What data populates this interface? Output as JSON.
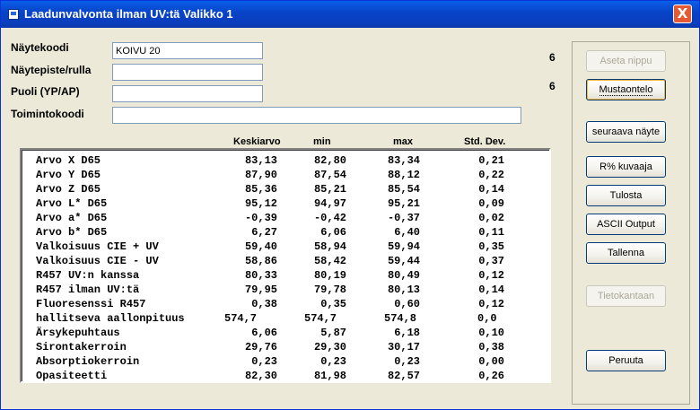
{
  "window": {
    "title": "Laadunvalvonta ilman UV:tä  Valikko 1",
    "close_label": "X"
  },
  "form": {
    "sample_code": {
      "label": "Näytekoodi",
      "value": "KOIVU 20"
    },
    "sample_point": {
      "label": "Näytepiste/rulla",
      "value": ""
    },
    "side": {
      "label": "Puoli (YP/AP)",
      "value": ""
    },
    "action_code": {
      "label": "Toimintokoodi",
      "value": ""
    }
  },
  "counts": {
    "bundle": "6",
    "black_cavity": "6"
  },
  "buttons": {
    "set_bundle": "Aseta nippu",
    "black_cavity": "Mustaontelo",
    "next_sample": "seuraava näyte",
    "r_percent_graph": "R% kuvaaja",
    "print": "Tulosta",
    "ascii_output": "ASCII Output",
    "save": "Tallenna",
    "database": "Tietokantaan",
    "cancel": "Peruuta"
  },
  "table": {
    "headers": {
      "avg": "Keskiarvo",
      "min": "min",
      "max": "max",
      "std": "Std. Dev."
    },
    "rows": [
      {
        "name": "Arvo X D65",
        "avg": "83,13",
        "min": "82,80",
        "max": "83,34",
        "std": "0,21"
      },
      {
        "name": "Arvo Y D65",
        "avg": "87,90",
        "min": "87,54",
        "max": "88,12",
        "std": "0,22"
      },
      {
        "name": "Arvo Z D65",
        "avg": "85,36",
        "min": "85,21",
        "max": "85,54",
        "std": "0,14"
      },
      {
        "name": "Arvo L* D65",
        "avg": "95,12",
        "min": "94,97",
        "max": "95,21",
        "std": "0,09"
      },
      {
        "name": "Arvo a* D65",
        "avg": "-0,39",
        "min": "-0,42",
        "max": "-0,37",
        "std": "0,02"
      },
      {
        "name": "Arvo b* D65",
        "avg": "6,27",
        "min": "6,06",
        "max": "6,40",
        "std": "0,11"
      },
      {
        "name": "Valkoisuus CIE + UV",
        "avg": "59,40",
        "min": "58,94",
        "max": "59,94",
        "std": "0,35"
      },
      {
        "name": "Valkoisuus CIE - UV",
        "avg": "58,86",
        "min": "58,42",
        "max": "59,44",
        "std": "0,37"
      },
      {
        "name": "R457 UV:n kanssa",
        "avg": "80,33",
        "min": "80,19",
        "max": "80,49",
        "std": "0,12"
      },
      {
        "name": "R457 ilman UV:tä",
        "avg": "79,95",
        "min": "79,78",
        "max": "80,13",
        "std": "0,14"
      },
      {
        "name": "Fluoresenssi R457",
        "avg": "0,38",
        "min": "0,35",
        "max": "0,60",
        "std": "0,12"
      },
      {
        "name": "hallitseva aallonpituus",
        "avg": "574,7",
        "min": "574,7",
        "max": "574,8",
        "std": "0,0"
      },
      {
        "name": "Ärsykepuhtaus",
        "avg": "6,06",
        "min": "5,87",
        "max": "6,18",
        "std": "0,10"
      },
      {
        "name": "Sirontakerroin",
        "avg": "29,76",
        "min": "29,30",
        "max": "30,17",
        "std": "0,38"
      },
      {
        "name": "Absorptiokerroin",
        "avg": "0,23",
        "min": "0,23",
        "max": "0,23",
        "std": "0,00"
      },
      {
        "name": "Opasiteetti",
        "avg": "82,30",
        "min": "81,98",
        "max": "82,57",
        "std": "0,26"
      }
    ]
  }
}
